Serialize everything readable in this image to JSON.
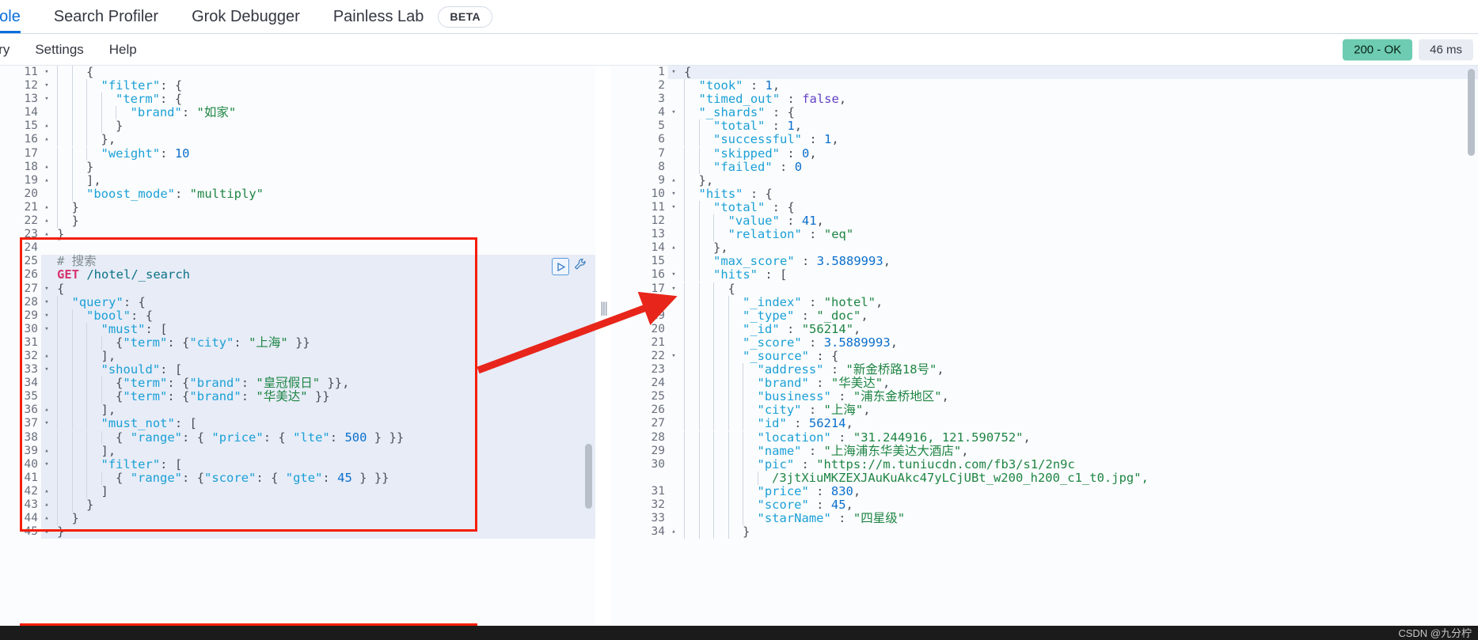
{
  "tabs": [
    {
      "label": "nsole",
      "active": true,
      "badge": null
    },
    {
      "label": "Search Profiler",
      "active": false,
      "badge": null
    },
    {
      "label": "Grok Debugger",
      "active": false,
      "badge": null
    },
    {
      "label": "Painless Lab",
      "active": false,
      "badge": "BETA"
    }
  ],
  "menu": {
    "items": [
      "tory",
      "Settings",
      "Help"
    ]
  },
  "status": {
    "response_code": "200 - OK",
    "response_time": "46 ms",
    "ok_color": "#6dccb1",
    "time_bg": "#e9edf3"
  },
  "annotation": {
    "box_color": "#f51d07",
    "arrow_color": "#e8251a"
  },
  "request_editor": {
    "name": "console-request-editor",
    "run_button": "run-request-button",
    "wrench_button": "request-options-wrench",
    "lines": [
      {
        "n": "11",
        "fold": "▾",
        "indent": 2,
        "text": "{",
        "cls": "p"
      },
      {
        "n": "12",
        "fold": "▾",
        "indent": 3,
        "text": "\"filter\": {",
        "cls": "k"
      },
      {
        "n": "13",
        "fold": "▾",
        "indent": 4,
        "text": "\"term\": {",
        "cls": "k"
      },
      {
        "n": "14",
        "fold": "",
        "indent": 5,
        "text": "\"brand\": \"如家\"",
        "cls": "kv"
      },
      {
        "n": "15",
        "fold": "▴",
        "indent": 4,
        "text": "}",
        "cls": "p"
      },
      {
        "n": "16",
        "fold": "▴",
        "indent": 3,
        "text": "},",
        "cls": "p"
      },
      {
        "n": "17",
        "fold": "",
        "indent": 3,
        "text": "\"weight\": 10",
        "cls": "kn"
      },
      {
        "n": "18",
        "fold": "▴",
        "indent": 2,
        "text": "}",
        "cls": "p"
      },
      {
        "n": "19",
        "fold": "▴",
        "indent": 2,
        "text": "],",
        "cls": "p"
      },
      {
        "n": "20",
        "fold": "",
        "indent": 2,
        "text": "\"boost_mode\": \"multiply\"",
        "cls": "kv"
      },
      {
        "n": "21",
        "fold": "▴",
        "indent": 1,
        "text": "}",
        "cls": "p"
      },
      {
        "n": "22",
        "fold": "▴",
        "indent": 1,
        "text": "}",
        "cls": "p"
      },
      {
        "n": "23",
        "fold": "▴",
        "indent": 0,
        "text": "}",
        "cls": "p"
      },
      {
        "n": "24",
        "fold": "",
        "indent": 0,
        "text": "",
        "cls": "p"
      },
      {
        "n": "25",
        "fold": "",
        "indent": 0,
        "text": "# 搜索",
        "cls": "c",
        "sel": true
      },
      {
        "n": "26",
        "fold": "",
        "indent": 0,
        "text": "GET /hotel/_search",
        "cls": "method",
        "sel": true
      },
      {
        "n": "27",
        "fold": "▾",
        "indent": 0,
        "text": "{",
        "cls": "p",
        "sel": true
      },
      {
        "n": "28",
        "fold": "▾",
        "indent": 1,
        "text": "\"query\": {",
        "cls": "k",
        "sel": true
      },
      {
        "n": "29",
        "fold": "▾",
        "indent": 2,
        "text": "\"bool\": {",
        "cls": "k",
        "sel": true
      },
      {
        "n": "30",
        "fold": "▾",
        "indent": 3,
        "text": "\"must\": [",
        "cls": "k",
        "sel": true
      },
      {
        "n": "31",
        "fold": "",
        "indent": 4,
        "text": "{\"term\": {\"city\": \"上海\" }}",
        "cls": "kv",
        "sel": true
      },
      {
        "n": "32",
        "fold": "▴",
        "indent": 3,
        "text": "],",
        "cls": "p",
        "sel": true
      },
      {
        "n": "33",
        "fold": "▾",
        "indent": 3,
        "text": "\"should\": [",
        "cls": "k",
        "sel": true
      },
      {
        "n": "34",
        "fold": "",
        "indent": 4,
        "text": "{\"term\": {\"brand\": \"皇冠假日\" }},",
        "cls": "kv",
        "sel": true
      },
      {
        "n": "35",
        "fold": "",
        "indent": 4,
        "text": "{\"term\": {\"brand\": \"华美达\" }}",
        "cls": "kv",
        "sel": true
      },
      {
        "n": "36",
        "fold": "▴",
        "indent": 3,
        "text": "],",
        "cls": "p",
        "sel": true
      },
      {
        "n": "37",
        "fold": "▾",
        "indent": 3,
        "text": "\"must_not\": [",
        "cls": "k",
        "sel": true
      },
      {
        "n": "38",
        "fold": "",
        "indent": 4,
        "text": "{ \"range\": { \"price\": { \"lte\": 500 } }}",
        "cls": "kn",
        "sel": true
      },
      {
        "n": "39",
        "fold": "▴",
        "indent": 3,
        "text": "],",
        "cls": "p",
        "sel": true
      },
      {
        "n": "40",
        "fold": "▾",
        "indent": 3,
        "text": "\"filter\": [",
        "cls": "k",
        "sel": true
      },
      {
        "n": "41",
        "fold": "",
        "indent": 4,
        "text": "{ \"range\": {\"score\": { \"gte\": 45 } }}",
        "cls": "kn",
        "sel": true
      },
      {
        "n": "42",
        "fold": "▴",
        "indent": 3,
        "text": "]",
        "cls": "p",
        "sel": true
      },
      {
        "n": "43",
        "fold": "▴",
        "indent": 2,
        "text": "}",
        "cls": "p",
        "sel": true
      },
      {
        "n": "44",
        "fold": "▴",
        "indent": 1,
        "text": "}",
        "cls": "p",
        "sel": true
      },
      {
        "n": "45",
        "fold": "▴",
        "indent": 0,
        "text": "}",
        "cls": "p",
        "sel": true
      }
    ]
  },
  "response_editor": {
    "name": "console-response-editor",
    "lines": [
      {
        "n": "1",
        "fold": "▾",
        "indent": 0,
        "text": "{",
        "cls": "p",
        "hl": true
      },
      {
        "n": "2",
        "fold": "",
        "indent": 1,
        "text": "\"took\" : 1,",
        "cls": "kn"
      },
      {
        "n": "3",
        "fold": "",
        "indent": 1,
        "text": "\"timed_out\" : false,",
        "cls": "kb"
      },
      {
        "n": "4",
        "fold": "▾",
        "indent": 1,
        "text": "\"_shards\" : {",
        "cls": "k"
      },
      {
        "n": "5",
        "fold": "",
        "indent": 2,
        "text": "\"total\" : 1,",
        "cls": "kn"
      },
      {
        "n": "6",
        "fold": "",
        "indent": 2,
        "text": "\"successful\" : 1,",
        "cls": "kn"
      },
      {
        "n": "7",
        "fold": "",
        "indent": 2,
        "text": "\"skipped\" : 0,",
        "cls": "kn"
      },
      {
        "n": "8",
        "fold": "",
        "indent": 2,
        "text": "\"failed\" : 0",
        "cls": "kn"
      },
      {
        "n": "9",
        "fold": "▴",
        "indent": 1,
        "text": "},",
        "cls": "p"
      },
      {
        "n": "10",
        "fold": "▾",
        "indent": 1,
        "text": "\"hits\" : {",
        "cls": "k"
      },
      {
        "n": "11",
        "fold": "▾",
        "indent": 2,
        "text": "\"total\" : {",
        "cls": "k"
      },
      {
        "n": "12",
        "fold": "",
        "indent": 3,
        "text": "\"value\" : 41,",
        "cls": "kn"
      },
      {
        "n": "13",
        "fold": "",
        "indent": 3,
        "text": "\"relation\" : \"eq\"",
        "cls": "kv"
      },
      {
        "n": "14",
        "fold": "▴",
        "indent": 2,
        "text": "},",
        "cls": "p"
      },
      {
        "n": "15",
        "fold": "",
        "indent": 2,
        "text": "\"max_score\" : 3.5889993,",
        "cls": "kn"
      },
      {
        "n": "16",
        "fold": "▾",
        "indent": 2,
        "text": "\"hits\" : [",
        "cls": "k"
      },
      {
        "n": "17",
        "fold": "▾",
        "indent": 3,
        "text": "{",
        "cls": "p"
      },
      {
        "n": "18",
        "fold": "",
        "indent": 4,
        "text": "\"_index\" : \"hotel\",",
        "cls": "kv"
      },
      {
        "n": "19",
        "fold": "",
        "indent": 4,
        "text": "\"_type\" : \"_doc\",",
        "cls": "kv"
      },
      {
        "n": "20",
        "fold": "",
        "indent": 4,
        "text": "\"_id\" : \"56214\",",
        "cls": "kv"
      },
      {
        "n": "21",
        "fold": "",
        "indent": 4,
        "text": "\"_score\" : 3.5889993,",
        "cls": "kn"
      },
      {
        "n": "22",
        "fold": "▾",
        "indent": 4,
        "text": "\"_source\" : {",
        "cls": "k"
      },
      {
        "n": "23",
        "fold": "",
        "indent": 5,
        "text": "\"address\" : \"新金桥路18号\",",
        "cls": "kv"
      },
      {
        "n": "24",
        "fold": "",
        "indent": 5,
        "text": "\"brand\" : \"华美达\",",
        "cls": "kv"
      },
      {
        "n": "25",
        "fold": "",
        "indent": 5,
        "text": "\"business\" : \"浦东金桥地区\",",
        "cls": "kv"
      },
      {
        "n": "26",
        "fold": "",
        "indent": 5,
        "text": "\"city\" : \"上海\",",
        "cls": "kv"
      },
      {
        "n": "27",
        "fold": "",
        "indent": 5,
        "text": "\"id\" : 56214,",
        "cls": "kn"
      },
      {
        "n": "28",
        "fold": "",
        "indent": 5,
        "text": "\"location\" : \"31.244916, 121.590752\",",
        "cls": "kv"
      },
      {
        "n": "29",
        "fold": "",
        "indent": 5,
        "text": "\"name\" : \"上海浦东华美达大酒店\",",
        "cls": "kv"
      },
      {
        "n": "30",
        "fold": "",
        "indent": 5,
        "text": "\"pic\" : \"https://m.tuniucdn.com/fb3/s1/2n9c",
        "cls": "kv"
      },
      {
        "n": "",
        "fold": "",
        "indent": 6,
        "text": "/3jtXiuMKZEXJAuKuAkc47yLCjUBt_w200_h200_c1_t0.jpg\",",
        "cls": "cont"
      },
      {
        "n": "31",
        "fold": "",
        "indent": 5,
        "text": "\"price\" : 830,",
        "cls": "kn"
      },
      {
        "n": "32",
        "fold": "",
        "indent": 5,
        "text": "\"score\" : 45,",
        "cls": "kn"
      },
      {
        "n": "33",
        "fold": "",
        "indent": 5,
        "text": "\"starName\" : \"四星级\"",
        "cls": "kv"
      },
      {
        "n": "34",
        "fold": "▴",
        "indent": 4,
        "text": "}",
        "cls": "p"
      }
    ]
  },
  "watermark": {
    "text": "CSDN @九分柠"
  }
}
